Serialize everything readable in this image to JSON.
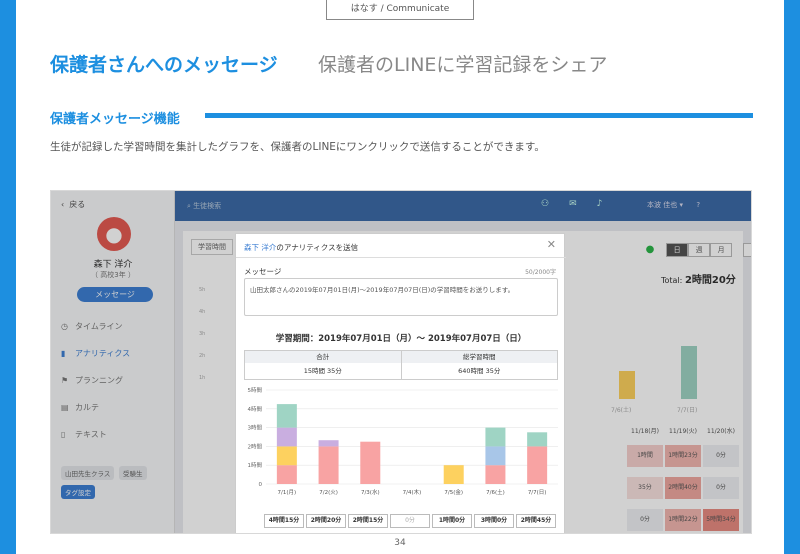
{
  "header": {
    "tab": "はなす / Communicate",
    "title": "保護者さんへのメッセージ",
    "subtitle": "保護者のLINEに学習記録をシェア"
  },
  "section": {
    "title": "保護者メッセージ機能",
    "description": "生徒が記録した学習時間を集計したグラフを、保護者のLINEにワンクリックで送信することができます。"
  },
  "app": {
    "back": "戻る",
    "student_name": "森下 洋介",
    "student_grade": "（ 高校3年 ）",
    "message_button": "メッセージ",
    "menu": [
      {
        "label": "タイムライン",
        "icon": "◷"
      },
      {
        "label": "アナリティクス",
        "icon": "▮"
      },
      {
        "label": "プランニング",
        "icon": "⚑"
      },
      {
        "label": "カルテ",
        "icon": "▤"
      },
      {
        "label": "テキスト",
        "icon": "▯"
      }
    ],
    "tags": [
      "山田先生クラス",
      "受験生"
    ],
    "tag_settings": "タグ設定",
    "search_placeholder": "生徒検索",
    "top_user": "本波 佳也",
    "bg_tab": "学習時間",
    "view_buttons": [
      "日",
      "週",
      "月"
    ],
    "total_label": "Total:",
    "total_value": "2時間20分",
    "bg_axis": [
      "5h",
      "4h",
      "3h",
      "2h",
      "1h"
    ],
    "bg_labels": [
      "7/6(土)",
      "7/7(日)"
    ],
    "heatmap": [
      [
        "11/18(月)",
        "11/19(火)",
        "11/20(水)"
      ],
      [
        "1時間",
        "1時間23分",
        "0分"
      ],
      [
        "35分",
        "2時間40分",
        "0分"
      ],
      [
        "0分",
        "1時間22分",
        "5時間34分"
      ]
    ]
  },
  "modal": {
    "title_name": "森下 洋介",
    "title_rest": "のアナリティクスを送信",
    "message_label": "メッセージ",
    "counter": "50/2000字",
    "message_text": "山田太郎さんの2019年07月01日(月)〜2019年07月07日(日)の学習時間をお送りします。",
    "period": "学習期間：2019年07月01日（月）〜 2019年07月07日（日）",
    "summary_headers": [
      "合計",
      "総学習時間"
    ],
    "summary_values": [
      "15時間 35分",
      "640時間 35分"
    ],
    "daily_totals": [
      "4時間15分",
      "2時間20分",
      "2時間15分",
      "0分",
      "1時間0分",
      "3時間0分",
      "2時間45分"
    ]
  },
  "chart_data": {
    "type": "bar",
    "stacked": true,
    "categories": [
      "7/1(月)",
      "7/2(火)",
      "7/3(水)",
      "7/4(木)",
      "7/5(金)",
      "7/6(土)",
      "7/7(日)"
    ],
    "ylim": [
      0,
      5
    ],
    "yticks": [
      "0",
      "1時間",
      "2時間",
      "3時間",
      "4時間",
      "5時間"
    ],
    "series": [
      {
        "color": "#f8a3a3",
        "values": [
          1.0,
          2.0,
          2.25,
          0,
          0,
          1.0,
          2.0
        ]
      },
      {
        "color": "#fdd15f",
        "values": [
          1.0,
          0,
          0,
          0,
          1.0,
          0,
          0
        ]
      },
      {
        "color": "#a8c6e8",
        "values": [
          0,
          0,
          0,
          0,
          0,
          1.0,
          0
        ]
      },
      {
        "color": "#c9aee0",
        "values": [
          1.0,
          0.33,
          0,
          0,
          0,
          0,
          0
        ]
      },
      {
        "color": "#9fd4c4",
        "values": [
          1.25,
          0,
          0,
          0,
          0,
          1.0,
          0.75
        ]
      }
    ]
  },
  "page": {
    "number": "34"
  }
}
